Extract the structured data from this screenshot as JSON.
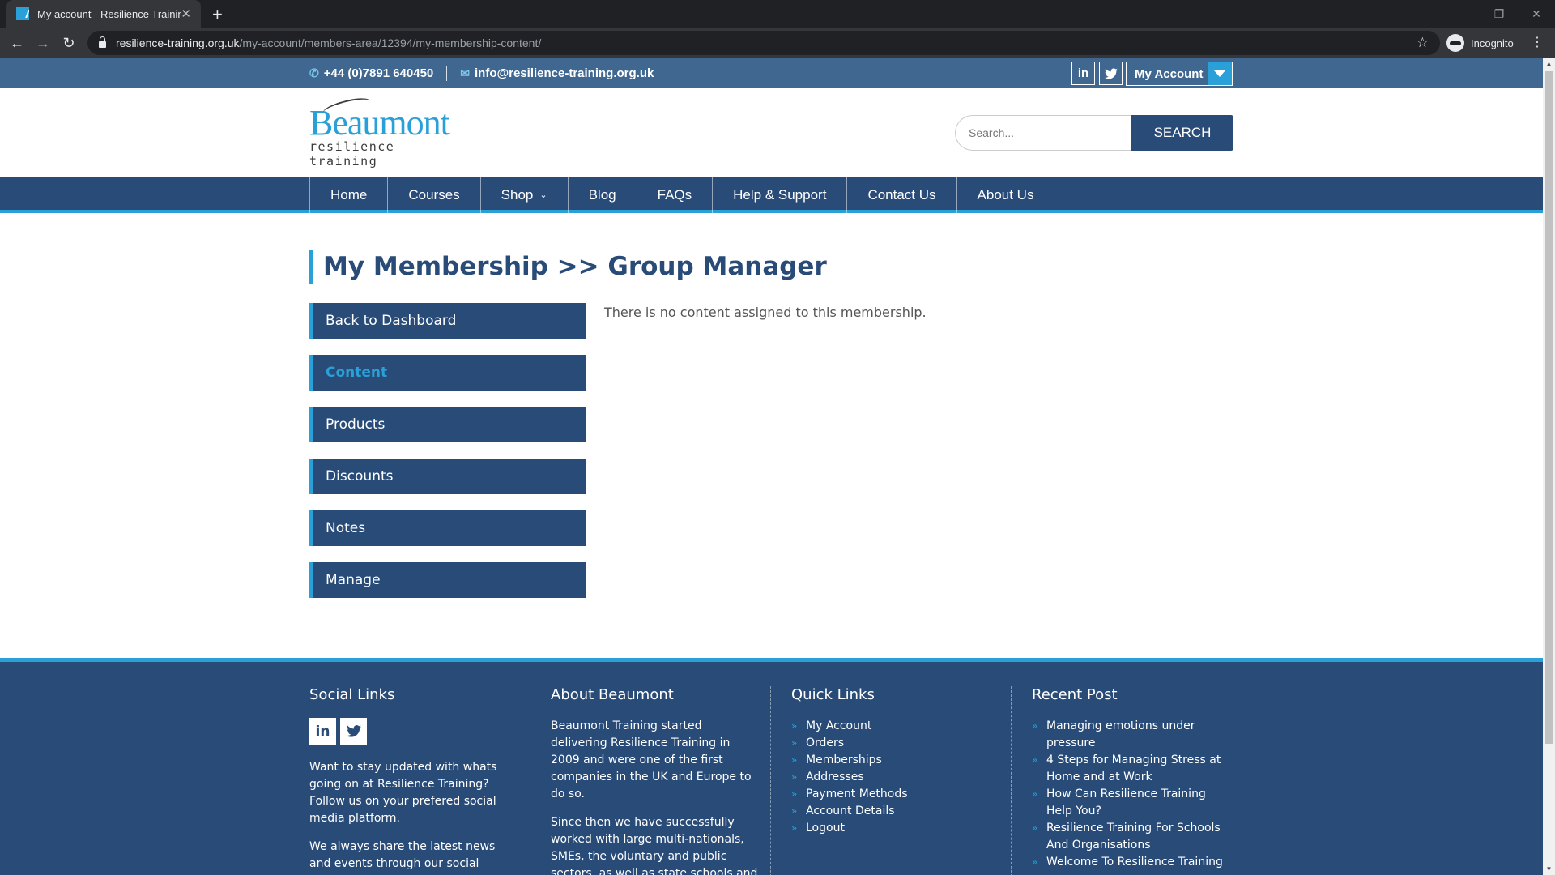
{
  "browser": {
    "tab_title": "My account - Resilience Training",
    "new_tab": "+",
    "url_host": "resilience-training.org.uk",
    "url_path": "/my-account/members-area/12394/my-membership-content/",
    "incognito_label": "Incognito"
  },
  "topbar": {
    "phone": "+44 (0)7891 640450",
    "email": "info@resilience-training.org.uk",
    "linkedin": "in",
    "my_account": "My Account"
  },
  "logo": {
    "name": "Beaumont",
    "tagline": "resilience training"
  },
  "search": {
    "placeholder": "Search...",
    "button": "SEARCH"
  },
  "nav": {
    "items": [
      "Home",
      "Courses",
      "Shop",
      "Blog",
      "FAQs",
      "Help & Support",
      "Contact Us",
      "About Us"
    ]
  },
  "page": {
    "heading": "My Membership >> Group Manager",
    "message": "There is no content assigned to this membership.",
    "menu": [
      "Back to Dashboard",
      "Content",
      "Products",
      "Discounts",
      "Notes",
      "Manage"
    ]
  },
  "footer": {
    "social": {
      "title": "Social Links",
      "linkedin": "in",
      "p1": "Want to stay updated with whats going on at Resilience Training? Follow us on your prefered social media platform.",
      "p2": "We always share the latest news and events through our social networks."
    },
    "about": {
      "title": "About Beaumont",
      "p1": "Beaumont Training started delivering Resilience Training in 2009 and were one of the first companies in the UK and Europe to do so.",
      "p2": "Since then we have successfully worked with large multi-nationals, SMEs, the voluntary and public sectors, as well as state schools and independent schools."
    },
    "quick": {
      "title": "Quick Links",
      "items": [
        "My Account",
        "Orders",
        "Memberships",
        "Addresses",
        "Payment Methods",
        "Account Details",
        "Logout"
      ]
    },
    "recent": {
      "title": "Recent Post",
      "items": [
        "Managing emotions under pressure",
        "4 Steps for Managing Stress at Home and at Work",
        "How Can Resilience Training Help You?",
        "Resilience Training For Schools And Organisations",
        "Welcome To Resilience Training"
      ]
    }
  },
  "colors": {
    "primary": "#284b78",
    "accent": "#2aa0d8",
    "topstrip": "#3f6790"
  }
}
